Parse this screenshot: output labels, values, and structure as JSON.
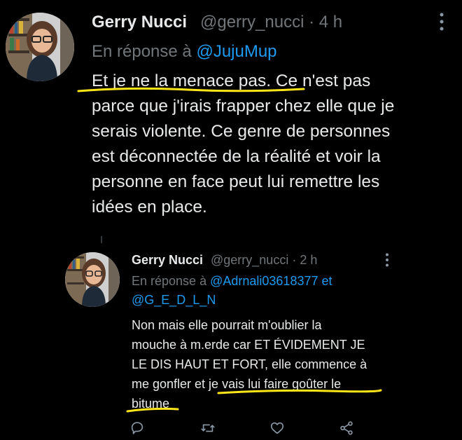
{
  "tweet1": {
    "display_name": "Gerry Nucci",
    "handle": "@gerry_nucci",
    "separator": "·",
    "time": "4 h",
    "reply_prefix": "En réponse à",
    "reply_to": "@JujuMup",
    "lines": [
      "Et je ne la menace pas. Ce n'est pas",
      "parce que j'irais frapper chez elle que je",
      "serais violente. Ce genre de personnes",
      "est déconnectée de la réalité et voir la",
      "personne en face peut lui remettre les",
      "idées en place."
    ]
  },
  "tweet2": {
    "display_name": "Gerry Nucci",
    "handle": "@gerry_nucci",
    "separator": "·",
    "time": "2 h",
    "reply_prefix": "En réponse à",
    "reply_to_1": "@Adrnali03618377",
    "reply_and": "et",
    "reply_to_2": "@G_E_D_L_N",
    "lines": [
      "Non mais elle pourrait m'oublier la",
      "mouche à m.erde car ET ÉVIDEMENT JE",
      "LE DIS HAUT ET FORT, elle commence à",
      "me gonfler et je vais lui faire goûter le",
      "bitume"
    ]
  },
  "colors": {
    "background": "#000000",
    "text": "#e7e9ea",
    "secondary": "#71767b",
    "link": "#1d9bf0",
    "highlight": "#ffe619"
  },
  "icons": [
    "more-vertical-icon",
    "reply-icon",
    "retweet-icon",
    "like-icon",
    "share-icon"
  ]
}
